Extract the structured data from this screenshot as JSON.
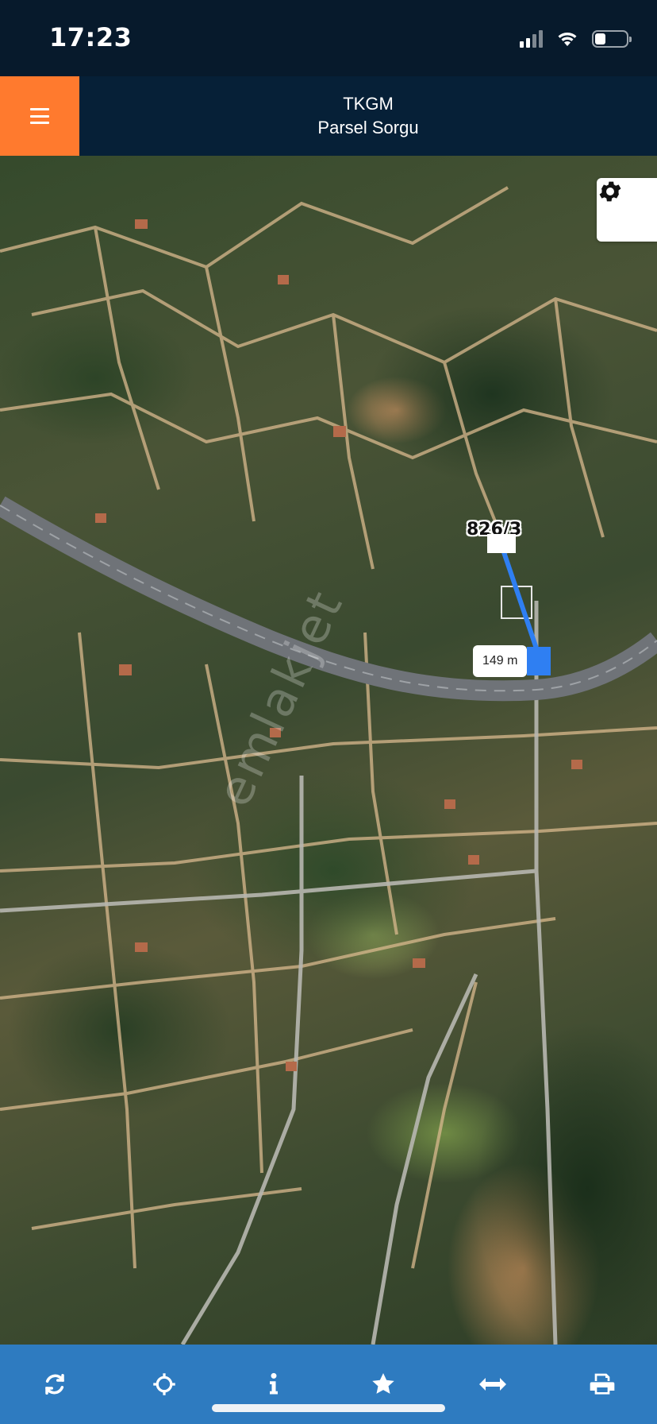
{
  "status_bar": {
    "time": "17:23",
    "icons": [
      "cellular-signal-icon",
      "wifi-icon",
      "battery-icon"
    ]
  },
  "header": {
    "menu_icon": "hamburger-menu-icon",
    "title": "TKGM",
    "subtitle": "Parsel Sorgu",
    "accent_color": "#ff7a2e",
    "background_color": "#062037"
  },
  "map": {
    "settings_icon": "gear-icon",
    "parcel_label": "826/3",
    "distance_label": "149 m",
    "measure_line_color": "#2f7ff2"
  },
  "toolbar": {
    "background_color": "#2e7bc0",
    "buttons": [
      {
        "name": "refresh-button",
        "icon": "refresh-icon"
      },
      {
        "name": "locate-button",
        "icon": "crosshair-icon"
      },
      {
        "name": "info-button",
        "icon": "info-icon"
      },
      {
        "name": "favorite-button",
        "icon": "star-icon"
      },
      {
        "name": "measure-button",
        "icon": "horizontal-arrows-icon"
      },
      {
        "name": "print-button",
        "icon": "printer-icon"
      }
    ]
  }
}
